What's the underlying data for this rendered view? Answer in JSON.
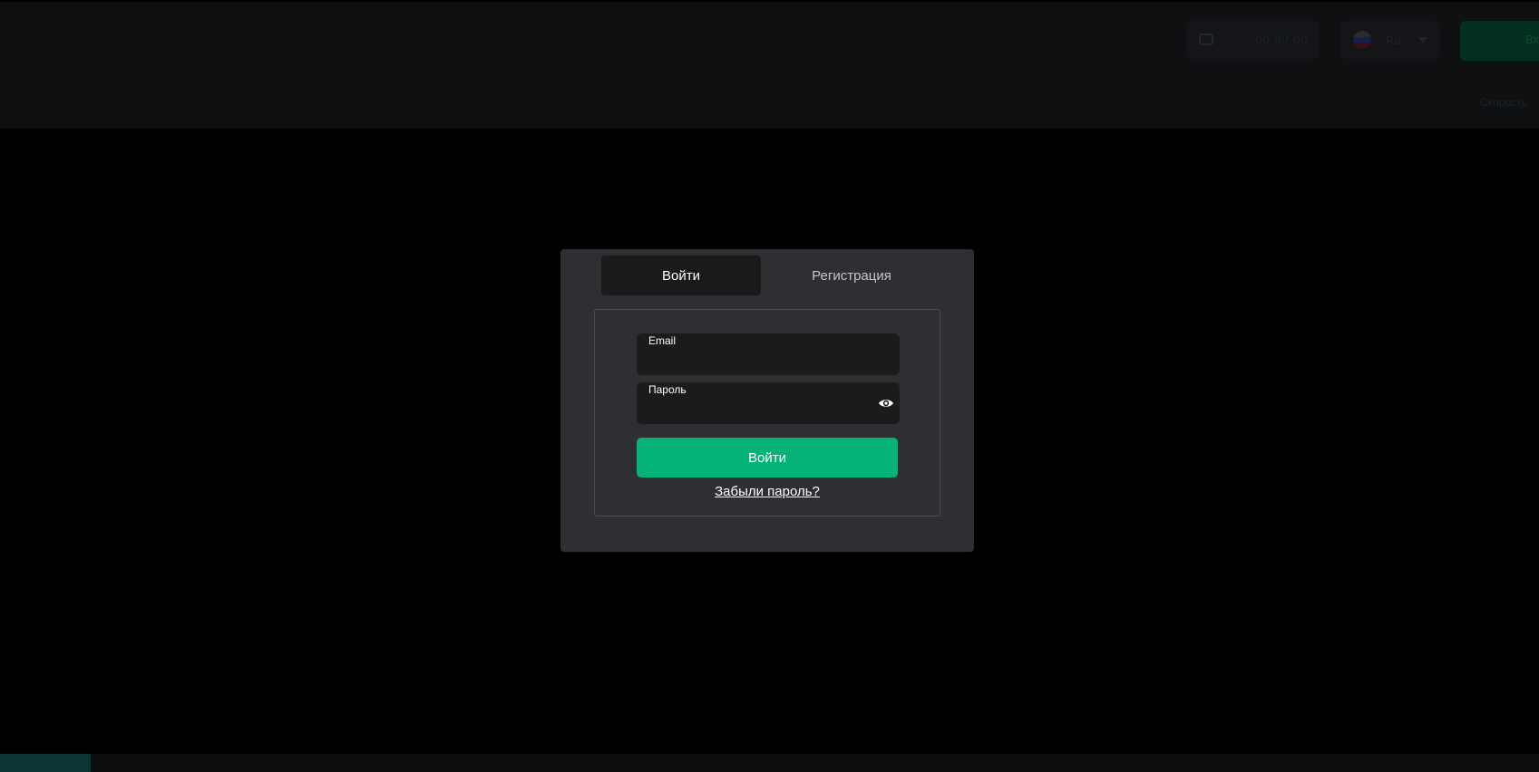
{
  "background": {
    "header": {
      "balance": {
        "icon": "wallet-icon",
        "text": "00 00,00"
      },
      "language": {
        "flag_icon": "russia-flag-icon",
        "label": "Ru",
        "chevron_icon": "chevron-down-icon"
      },
      "primary_button_label": "Вх",
      "subnav_text": "Скорость"
    }
  },
  "modal": {
    "tabs": [
      {
        "label": "Войти",
        "active": true
      },
      {
        "label": "Регистрация",
        "active": false
      }
    ],
    "form": {
      "email": {
        "label": "Email",
        "value": "",
        "placeholder": ""
      },
      "password": {
        "label": "Пароль",
        "value": "",
        "placeholder": "",
        "toggle_icon": "eye-icon"
      },
      "submit_label": "Войти",
      "forgot_label": "Забыли пароль?"
    }
  },
  "colors": {
    "page_background": "#000000",
    "modal_background": "#2e2f33",
    "active_tab_background": "#1a1a1a",
    "input_background": "#1b1b1b",
    "accent_green": "#04b375",
    "text_primary": "#ffffff",
    "text_muted": "#c4c6c9"
  }
}
